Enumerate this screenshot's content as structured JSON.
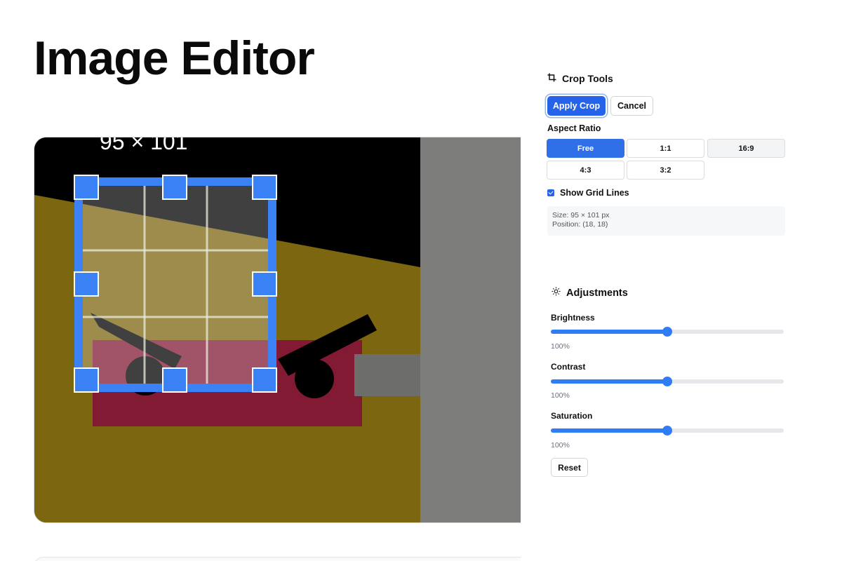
{
  "page": {
    "title": "Image Editor"
  },
  "canvas": {
    "size_overlay": "95 × 101",
    "show_grid": true
  },
  "crop_tools": {
    "title": "Crop Tools",
    "icon": "crop-icon",
    "apply_label": "Apply Crop",
    "cancel_label": "Cancel",
    "aspect_ratio_label": "Aspect Ratio",
    "ratios": [
      {
        "label": "Free",
        "active": true
      },
      {
        "label": "1:1",
        "active": false
      },
      {
        "label": "16:9",
        "active": false
      },
      {
        "label": "4:3",
        "active": false
      },
      {
        "label": "3:2",
        "active": false
      }
    ],
    "grid_lines_label": "Show Grid Lines",
    "grid_lines_checked": true,
    "info": {
      "size": "Size: 95 × 101 px",
      "position": "Position: (18, 18)"
    }
  },
  "adjustments": {
    "title": "Adjustments",
    "icon": "sun-icon",
    "sliders": [
      {
        "label": "Brightness",
        "value": "100%",
        "fraction": 0.5
      },
      {
        "label": "Contrast",
        "value": "100%",
        "fraction": 0.5
      },
      {
        "label": "Saturation",
        "value": "100%",
        "fraction": 0.5
      }
    ],
    "reset_label": "Reset"
  },
  "colors": {
    "accent": "#2563eb",
    "handle": "#3b82f6",
    "canvas_black": "#000000",
    "canvas_olive": "#7d6610",
    "canvas_crimson": "#821a34",
    "canvas_gray": "#7d7e7c"
  }
}
